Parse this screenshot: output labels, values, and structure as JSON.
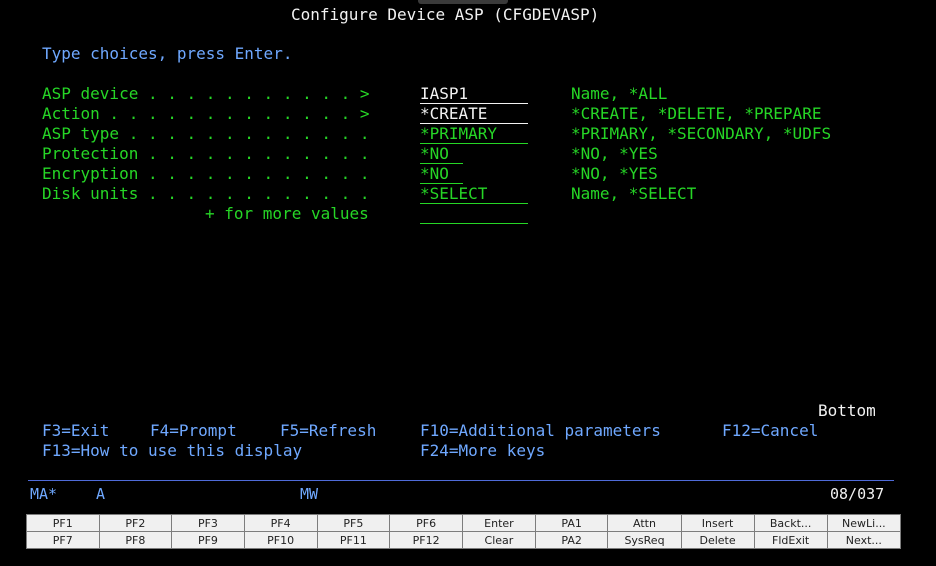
{
  "screen": {
    "title": "Configure Device ASP (CFGDEVASP)",
    "instruction": "Type choices, press Enter."
  },
  "params": [
    {
      "label": "ASP device . . . . . . . . . . . >",
      "value": "IASP1",
      "choices": "Name, *ALL"
    },
    {
      "label": "Action . . . . . . . . . . . . . >",
      "value": "*CREATE",
      "choices": "*CREATE, *DELETE, *PREPARE"
    },
    {
      "label": "ASP type . . . . . . . . . . . . .",
      "value": "*PRIMARY",
      "choices": "*PRIMARY, *SECONDARY, *UDFS"
    },
    {
      "label": "Protection . . . . . . . . . . . .",
      "value": "*NO",
      "choices": "*NO, *YES"
    },
    {
      "label": "Encryption . . . . . . . . . . . .",
      "value": "*NO",
      "choices": "*NO, *YES"
    },
    {
      "label": "Disk units . . . . . . . . . . . .",
      "value": "*SELECT",
      "choices": "Name, *SELECT"
    }
  ],
  "more_values": {
    "label": "+ for more values",
    "value": ""
  },
  "bottom_label": "Bottom",
  "fkeys": {
    "row1": [
      "F3=Exit",
      "F4=Prompt",
      "F5=Refresh",
      "F10=Additional parameters",
      "F12=Cancel"
    ],
    "row2": [
      "F13=How to use this display",
      "F24=More keys"
    ]
  },
  "status": {
    "ma": "MA*",
    "mode": "A",
    "mw": "MW",
    "cursor": "08/037"
  },
  "keypad": {
    "row1": [
      "PF1",
      "PF2",
      "PF3",
      "PF4",
      "PF5",
      "PF6",
      "Enter",
      "PA1",
      "Attn",
      "Insert",
      "Backt...",
      "NewLi..."
    ],
    "row2": [
      "PF7",
      "PF8",
      "PF9",
      "PF10",
      "PF11",
      "PF12",
      "Clear",
      "PA2",
      "SysReq",
      "Delete",
      "FldExit",
      "Next..."
    ]
  }
}
